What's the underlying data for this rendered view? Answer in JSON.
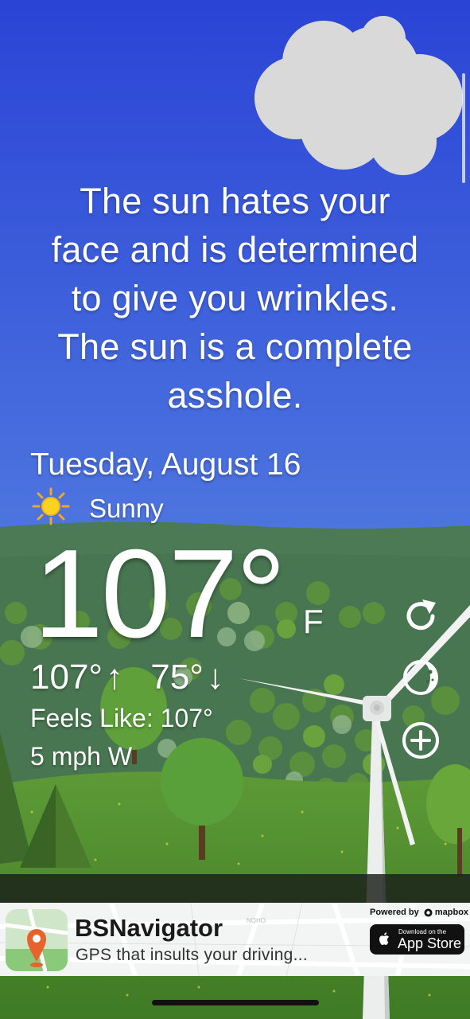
{
  "quote": {
    "lines": [
      "The sun hates your",
      "face and is determined",
      "to give you wrinkles.",
      "The sun is a complete",
      "asshole."
    ]
  },
  "weather": {
    "date": "Tuesday, August 16",
    "condition_icon": "sun-icon",
    "condition": "Sunny",
    "temperature": "107°",
    "unit": "F",
    "high": "107°",
    "high_arrow": "↑",
    "low": "75°",
    "low_arrow": "↓",
    "feels_like": "Feels Like: 107°",
    "wind": "5 mph W"
  },
  "actions": {
    "refresh_icon": "refresh-icon",
    "theme_icon": "moon-phase-icon",
    "add_icon": "add-circle-icon"
  },
  "ad": {
    "title": "BSNavigator",
    "subtitle": "GPS that insults your driving...",
    "powered_by": "Powered by",
    "powered_brand": "mapbox",
    "store_small": "Download on the",
    "store_big": "App Store",
    "map_label": "NOHO"
  },
  "colors": {
    "sky_top": "#2b45d6",
    "sky_bottom": "#6e9ae6",
    "hill": "#4a7a52",
    "grass": "#4a8a2c",
    "ad_background": "#f3f4f4",
    "pin": "#e8632c"
  }
}
